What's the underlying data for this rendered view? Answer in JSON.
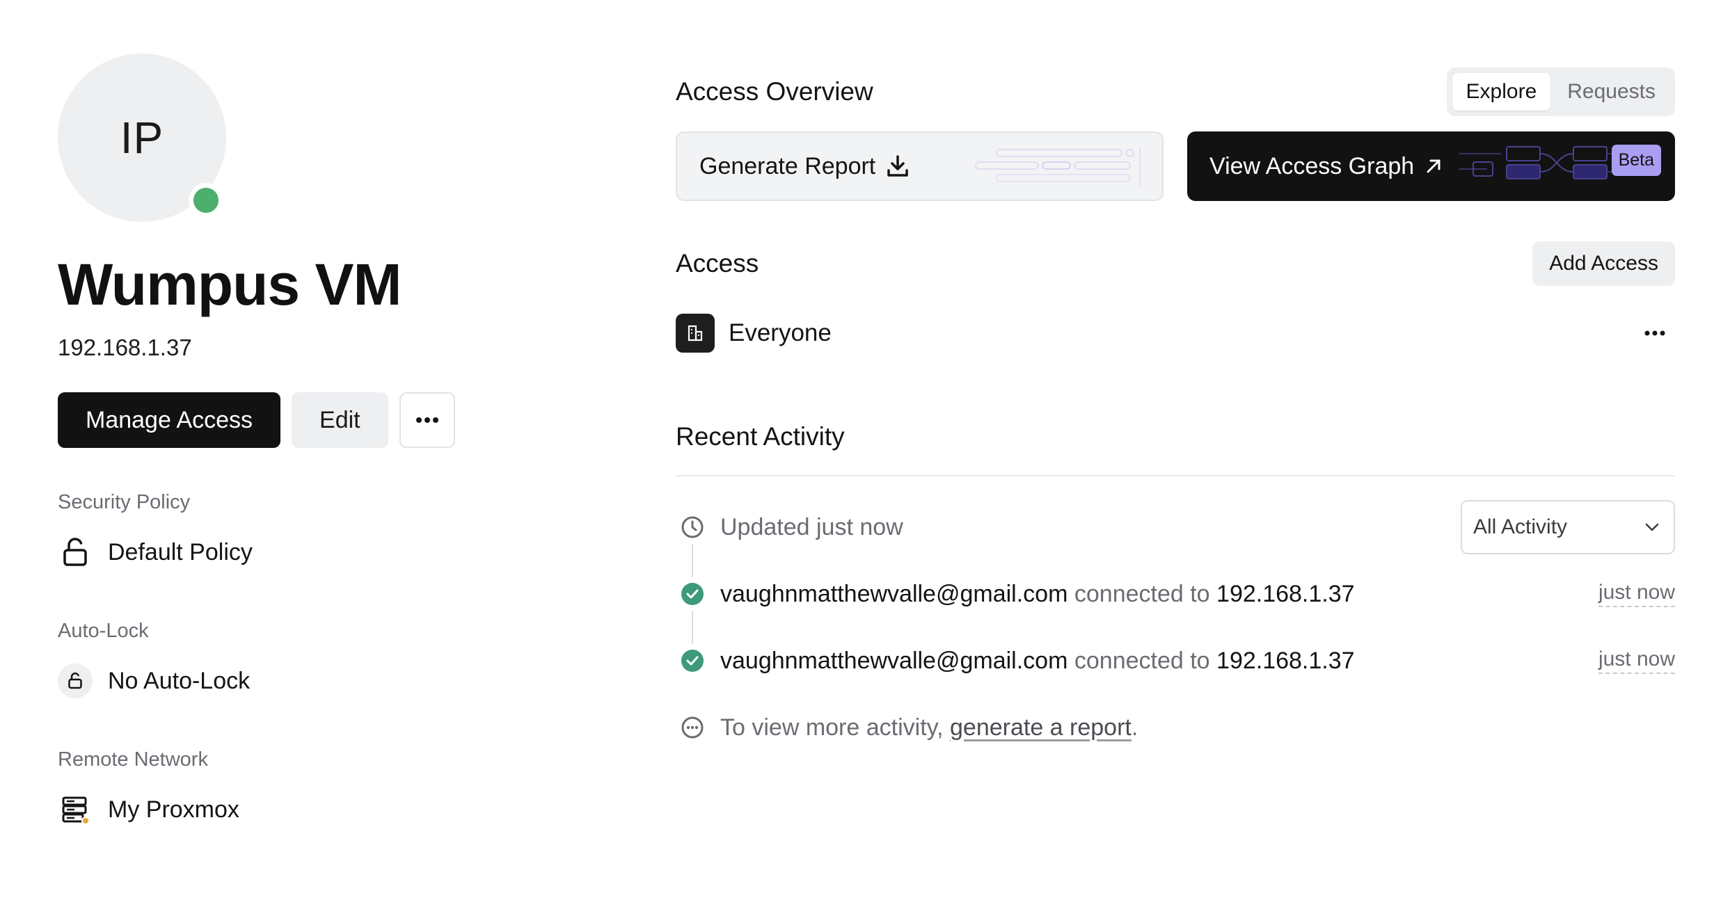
{
  "resource": {
    "initials": "IP",
    "name": "Wumpus VM",
    "address": "192.168.1.37",
    "status_color": "#4caf6e"
  },
  "actions": {
    "manage_access": "Manage Access",
    "edit": "Edit"
  },
  "properties": {
    "security_policy": {
      "label": "Security Policy",
      "value": "Default Policy",
      "icon": "unlock-icon"
    },
    "auto_lock": {
      "label": "Auto-Lock",
      "value": "No Auto-Lock",
      "icon": "unlock-small-icon"
    },
    "remote_network": {
      "label": "Remote Network",
      "value": "My Proxmox",
      "icon": "server-icon",
      "status_color": "#e8a93a"
    }
  },
  "access_overview": {
    "title": "Access Overview",
    "tabs": [
      {
        "label": "Explore",
        "active": true
      },
      {
        "label": "Requests",
        "active": false
      }
    ],
    "generate_report": "Generate Report",
    "view_graph": "View Access Graph",
    "beta_badge": "Beta"
  },
  "access": {
    "title": "Access",
    "add_button": "Add Access",
    "items": [
      {
        "name": "Everyone",
        "icon": "building-icon"
      }
    ]
  },
  "recent_activity": {
    "title": "Recent Activity",
    "updated": "Updated just now",
    "filter": "All Activity",
    "events": [
      {
        "user": "vaughnmatthewvalle@gmail.com",
        "verb": "connected to",
        "target": "192.168.1.37",
        "time": "just now"
      },
      {
        "user": "vaughnmatthewvalle@gmail.com",
        "verb": "connected to",
        "target": "192.168.1.37",
        "time": "just now"
      }
    ],
    "more_prefix": "To view more activity, ",
    "more_link": "generate a report",
    "more_suffix": "."
  }
}
